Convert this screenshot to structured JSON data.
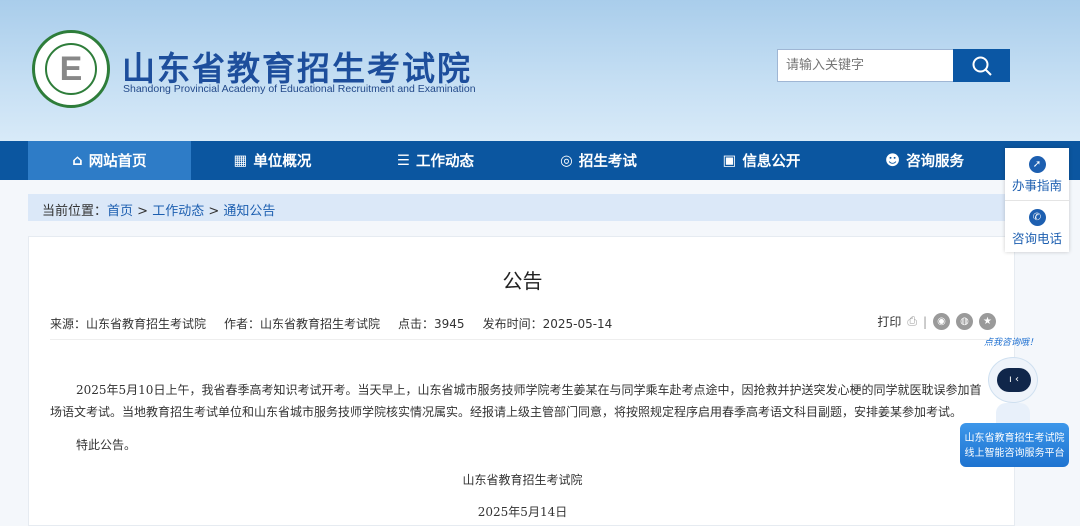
{
  "header": {
    "title": "山东省教育招生考试院",
    "subtitle": "Shandong Provincial Academy of Educational Recruitment and Examination",
    "logo_letter": "E",
    "search_placeholder": "请输入关键字"
  },
  "nav": [
    {
      "label": "网站首页",
      "icon": "⌂"
    },
    {
      "label": "单位概况",
      "icon": "▦"
    },
    {
      "label": "工作动态",
      "icon": "☰"
    },
    {
      "label": "招生考试",
      "icon": "◎"
    },
    {
      "label": "信息公开",
      "icon": "▣"
    },
    {
      "label": "咨询服务",
      "icon": "☻"
    }
  ],
  "breadcrumb": {
    "prefix": "当前位置：",
    "items": [
      "首页",
      "工作动态",
      "通知公告"
    ],
    "sep": " > "
  },
  "article": {
    "title": "公告",
    "source": "来源：山东省教育招生考试院",
    "author": "作者：山东省教育招生考试院",
    "clicks": "点击：3945",
    "date": "发布时间：2025-05-14",
    "print": "打印",
    "paragraphs": [
      "2025年5月10日上午，我省春季高考知识考试开考。当天早上，山东省城市服务技师学院考生姜某在与同学乘车赴考点途中，因抢救并护送突发心梗的同学就医耽误参加首场语文考试。当地教育招生考试单位和山东省城市服务技师学院核实情况属实。经报请上级主管部门同意，将按照规定程序启用春季高考语文科目副题，安排姜某参加考试。",
      "特此公告。"
    ],
    "signature": "山东省教育招生考试院",
    "sign_date": "2025年5月14日"
  },
  "float": {
    "guide": "办事指南",
    "phone": "咨询电话"
  },
  "robot": {
    "bubble": "点我咨询哦！",
    "line1": "山东省教育招生考试院",
    "line2": "线上智能咨询服务平台"
  }
}
